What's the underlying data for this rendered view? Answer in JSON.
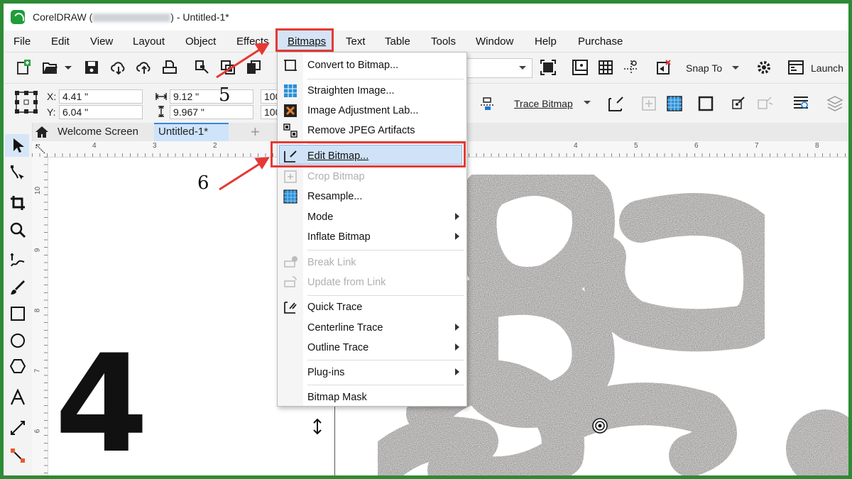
{
  "window": {
    "app_name": "CorelDRAW (",
    "edition_blurred": "Evaluation Version",
    "title_suffix": ") - Untitled-1*"
  },
  "menubar": {
    "items": [
      {
        "label": "File"
      },
      {
        "label": "Edit"
      },
      {
        "label": "View"
      },
      {
        "label": "Layout"
      },
      {
        "label": "Object"
      },
      {
        "label": "Effects"
      },
      {
        "label": "Bitmaps"
      },
      {
        "label": "Text"
      },
      {
        "label": "Table"
      },
      {
        "label": "Tools"
      },
      {
        "label": "Window"
      },
      {
        "label": "Help"
      },
      {
        "label": "Purchase"
      }
    ]
  },
  "toolbar": {
    "zoom_suffix": "%",
    "snap_label": "Snap To",
    "launch_label": "Launch"
  },
  "propbar": {
    "x_label": "X:",
    "x_value": "4.41 \"",
    "y_label": "Y:",
    "y_value": "6.04 \"",
    "width_value": "9.12 \"",
    "height_value": "9.967 \"",
    "scale_w": "100",
    "scale_h": "100",
    "trace_bitmap_label": "Trace Bitmap"
  },
  "tabs": {
    "welcome": "Welcome Screen",
    "document": "Untitled-1*",
    "add": "+"
  },
  "rulers": {
    "h_left": [
      "4",
      "3",
      "2"
    ],
    "h_right": [
      "4",
      "5",
      "6",
      "7",
      "8"
    ],
    "v": [
      "10",
      "9",
      "8",
      "7",
      "6"
    ]
  },
  "bitmaps_menu": {
    "items": [
      {
        "label": "Convert to Bitmap...",
        "enabled": true
      },
      {
        "label": "Straighten Image...",
        "enabled": true
      },
      {
        "label": "Image Adjustment Lab...",
        "enabled": true
      },
      {
        "label": "Remove JPEG Artifacts",
        "enabled": true
      },
      {
        "label": "Edit Bitmap...",
        "enabled": true
      },
      {
        "label": "Crop Bitmap",
        "enabled": false
      },
      {
        "label": "Resample...",
        "enabled": true
      },
      {
        "label": "Mode",
        "enabled": true
      },
      {
        "label": "Inflate Bitmap",
        "enabled": true
      },
      {
        "label": "Break Link",
        "enabled": false
      },
      {
        "label": "Update from Link",
        "enabled": false
      },
      {
        "label": "Quick Trace",
        "enabled": true
      },
      {
        "label": "Centerline Trace",
        "enabled": true
      },
      {
        "label": "Outline Trace",
        "enabled": true
      },
      {
        "label": "Plug-ins",
        "enabled": true
      },
      {
        "label": "Bitmap Mask",
        "enabled": true
      }
    ]
  },
  "annotations": {
    "step4": "4",
    "step5": "5",
    "step6": "6"
  },
  "colors": {
    "frame_green": "#2e8b35",
    "highlight_red": "#e53935",
    "menu_highlight": "#cfe2f7"
  }
}
